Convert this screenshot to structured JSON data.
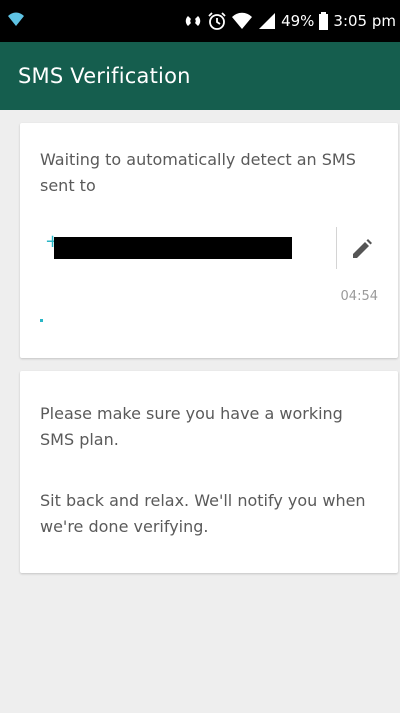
{
  "status_bar": {
    "battery_percent": "49%",
    "time": "3:05 pm",
    "icons": [
      "wifi-icon",
      "nfc-icon",
      "alarm-icon",
      "wifi-icon",
      "signal-icon",
      "battery-icon"
    ]
  },
  "app_bar": {
    "title": "SMS Verification",
    "color": "#155e4e"
  },
  "verification_card": {
    "waiting_text": "Waiting to automatically detect an SMS sent to",
    "phone_prefix": "+",
    "edit_icon": "pencil-icon",
    "timer": "04:54",
    "accent_color": "#29b6c6"
  },
  "info_card": {
    "paragraph_1": "Please make sure you have a working SMS plan.",
    "paragraph_2": "Sit back and relax. We'll notify you when we're done verifying."
  }
}
